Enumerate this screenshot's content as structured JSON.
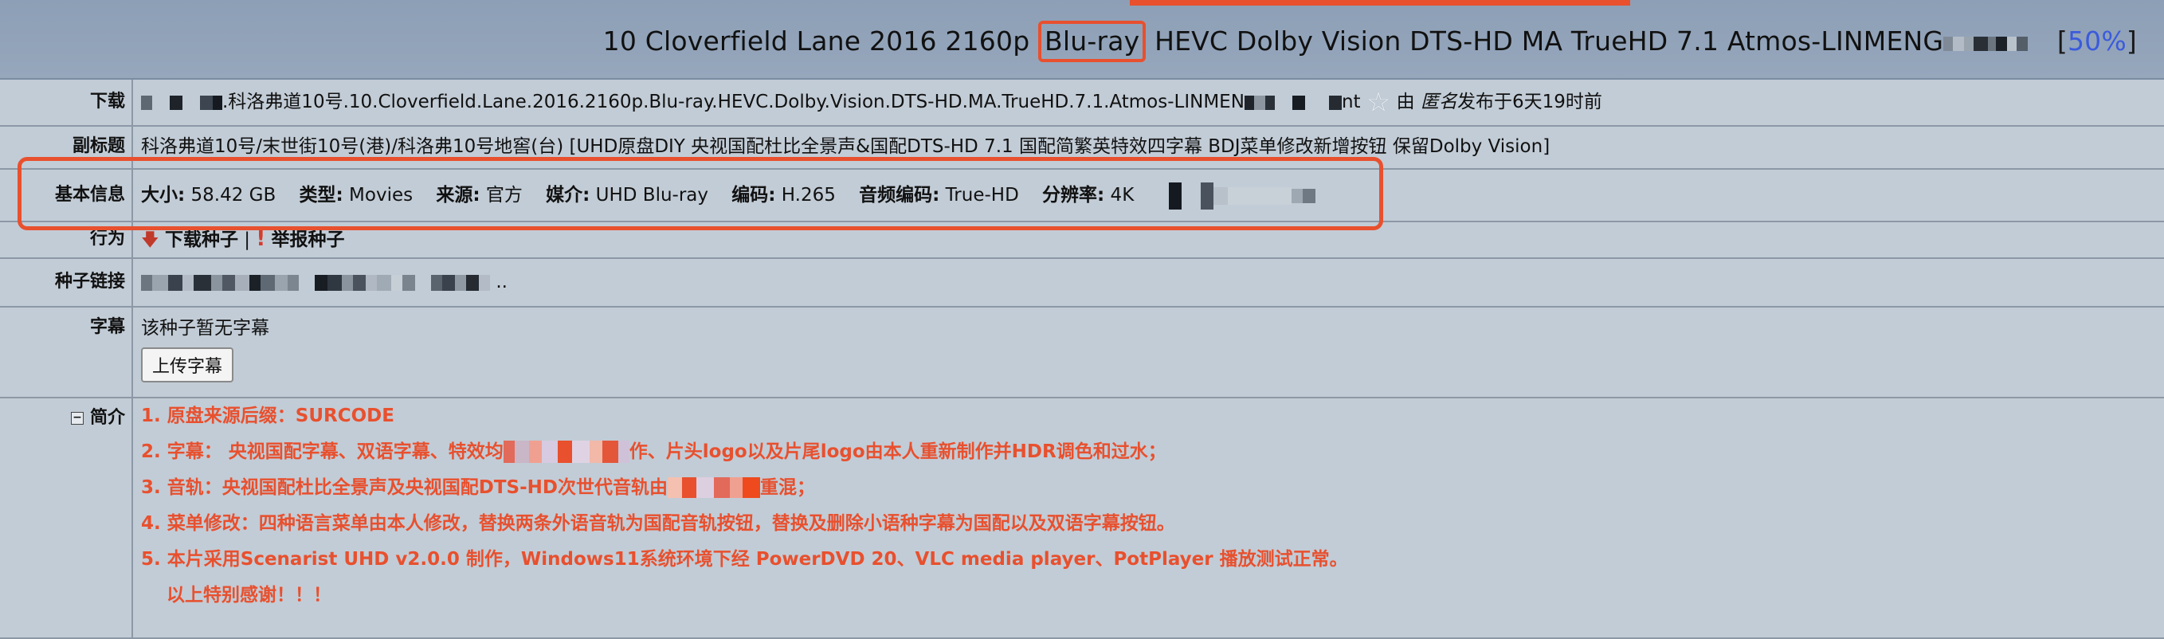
{
  "header": {
    "title_part1": "10 Cloverfield Lane 2016 2160p ",
    "title_highlight": "Blu-ray",
    "title_part2": " HEVC Dolby Vision DTS-HD MA TrueHD 7.1 Atmos-LINMENG",
    "bracket_open": "[",
    "percent": "50%",
    "bracket_close": "]"
  },
  "rows": {
    "download": {
      "label": "下载",
      "filename": ".科洛弗道10号.10.Cloverfield.Lane.2016.2160p.Blu-ray.HEVC.Dolby.Vision.DTS-HD.MA.TrueHD.7.1.Atmos-LINMEN",
      "suffix": "nt",
      "by": "由",
      "uploader": "匿名",
      "posted": "发布于6天19时前"
    },
    "subtitle": {
      "label": "副标题",
      "text": "科洛弗道10号/末世街10号(港)/科洛弗10号地窖(台) [UHD原盘DIY 央视国配杜比全景声&国配DTS-HD 7.1 国配简繁英特效四字幕 BDJ菜单修改新增按钮 保留Dolby Vision]"
    },
    "info": {
      "label": "基本信息",
      "fields": [
        {
          "k": "大小:",
          "v": " 58.42 GB"
        },
        {
          "k": "类型:",
          "v": " Movies"
        },
        {
          "k": "来源:",
          "v": " 官方"
        },
        {
          "k": "媒介:",
          "v": " UHD Blu-ray"
        },
        {
          "k": "编码:",
          "v": " H.265"
        },
        {
          "k": "音频编码:",
          "v": " True-HD"
        },
        {
          "k": "分辨率:",
          "v": " 4K"
        }
      ]
    },
    "action": {
      "label": "行为",
      "download": "下载种子",
      "sep": "|",
      "report": "举报种子"
    },
    "link": {
      "label": "种子链接",
      "tail": ".."
    },
    "subs": {
      "label": "字幕",
      "none_text": "该种子暂无字幕",
      "upload_button": "上传字幕"
    },
    "intro": {
      "label": "简介",
      "lines": [
        "1. 原盘来源后缀：SURCODE",
        "2. 字幕： 央视国配字幕、双语字幕、特效均",
        "作、片头logo以及片尾logo由本人重新制作并HDR调色和过水；",
        "3. 音轨：央视国配杜比全景声及央视国配DTS-HD次世代音轨由",
        "重混；",
        "4. 菜单修改：四种语言菜单由本人修改，替换两条外语音轨为国配音轨按钮，替换及删除小语种字幕为国配以及双语字幕按钮。",
        "5. 本片采用Scenarist UHD v2.0.0 制作，Windows11系统环境下经 PowerDVD 20、VLC media player、PotPlayer 播放测试正常。",
        "以上特别感谢！！！"
      ]
    }
  },
  "colors": {
    "accent": "#e8502e",
    "header_bg": "#8d9fb6",
    "page_bg": "#c2ccd6",
    "link": "#3b5bdb"
  }
}
